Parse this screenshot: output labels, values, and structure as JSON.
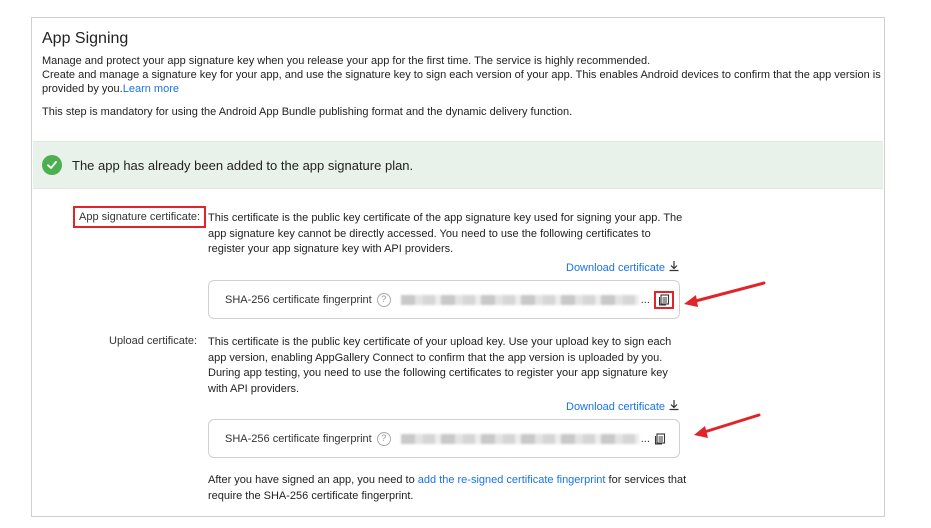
{
  "header": {
    "title": "App Signing",
    "description_line1": "Manage and protect your app signature key when you release your app for the first time. The service is highly recommended.",
    "description_line2": "Create and manage a signature key for your app, and use the signature key to sign each version of your app. This enables Android devices to confirm that the app version is provided by you.",
    "learn_more": "Learn more",
    "mandatory_note": "This step is mandatory for using the Android App Bundle publishing format and the dynamic delivery function."
  },
  "banner": {
    "text": "The app has already been added to the app signature plan.",
    "icon": "check-circle-icon",
    "color": "#4caf50"
  },
  "app_signature": {
    "label": "App signature certificate:",
    "description": "This certificate is the public key certificate of the app signature key used for signing your app. The app signature key cannot be directly accessed. You need to use the following certificates to register your app signature key with API providers.",
    "download_label": "Download certificate",
    "fingerprint_label": "SHA-256 certificate fingerprint",
    "ellipsis": "..."
  },
  "upload": {
    "label": "Upload certificate:",
    "description": "This certificate is the public key certificate of your upload key. Use your upload key to sign each app version, enabling AppGallery Connect to confirm that the app version is uploaded by you. During app testing, you need to use the following certificates to register your app signature key with API providers.",
    "download_label": "Download certificate",
    "fingerprint_label": "SHA-256 certificate fingerprint",
    "ellipsis": "..."
  },
  "footer": {
    "prefix": "After you have signed an app, you need to ",
    "link": "add the re-signed certificate fingerprint",
    "suffix": " for services that require the SHA-256 certificate fingerprint."
  },
  "colors": {
    "accent": "#1a73e8",
    "annotation_red": "#e0242a",
    "banner_bg": "#e9f2ea"
  }
}
